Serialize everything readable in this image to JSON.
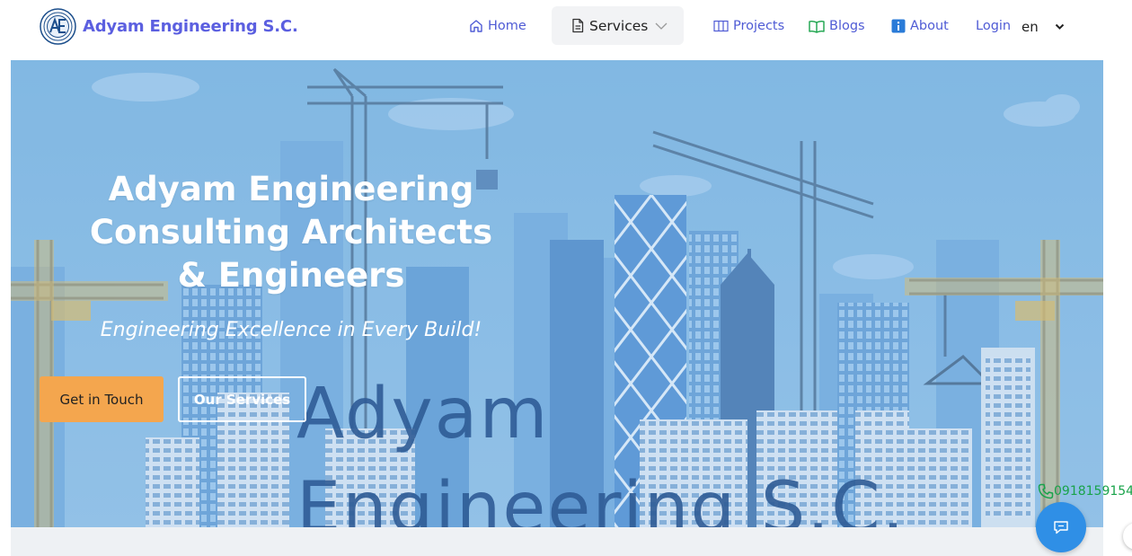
{
  "navbar": {
    "brand_name": "Adyam Engineering S.C.",
    "items": [
      {
        "label": "Home",
        "icon": "home-icon"
      },
      {
        "label": "Services",
        "icon": "document-icon"
      },
      {
        "label": "Projects",
        "icon": "columns-icon"
      },
      {
        "label": "Blogs",
        "icon": "book-icon"
      },
      {
        "label": "About",
        "icon": "info-icon"
      },
      {
        "label": "Login"
      }
    ],
    "language": "en"
  },
  "hero": {
    "title": "Adyam Engineering Consulting Architects & Engineers",
    "subtitle": "Engineering Excellence in Every Build!",
    "primary_button": "Get in Touch",
    "secondary_button": "Our Services",
    "watermark_line1": "Adyam",
    "watermark_line2": "Engineering S.C."
  },
  "contact": {
    "phone": "0918159154"
  },
  "colors": {
    "brand": "#5b5fe0",
    "accent": "#f4a64e",
    "hero_sky": "#7fb4df",
    "chat": "#2f8fe6",
    "phone": "#19a34a"
  }
}
